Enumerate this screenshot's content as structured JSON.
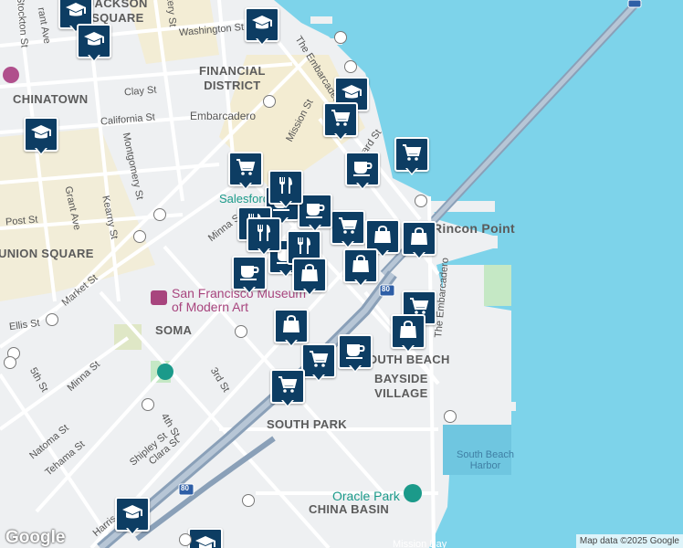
{
  "map": {
    "attribution": "Map data ©2025 Google",
    "logo": "Google",
    "colors": {
      "water": "#7dd3ea",
      "land": "#eef0f2",
      "park": "#c5e8c5",
      "highway": "#8aa0b8",
      "pin": "#0d3d63",
      "yellow": "#f7e9b8"
    }
  },
  "areas": [
    {
      "id": "jackson-square",
      "text": "JACKSON\nSQUARE"
    },
    {
      "id": "chinatown",
      "text": "CHINATOWN"
    },
    {
      "id": "financial-district",
      "text": "FINANCIAL\nDISTRICT"
    },
    {
      "id": "union-square",
      "text": "UNION SQUARE"
    },
    {
      "id": "soma",
      "text": "SOMA"
    },
    {
      "id": "south-beach",
      "text": "SOUTH BEACH"
    },
    {
      "id": "bayside-village",
      "text": "BAYSIDE\nVILLAGE"
    },
    {
      "id": "south-park",
      "text": "SOUTH PARK"
    },
    {
      "id": "china-basin",
      "text": "CHINA BASIN"
    },
    {
      "id": "rincon-point",
      "text": "Rincon Point"
    }
  ],
  "streets": [
    {
      "id": "washington-st",
      "text": "Washington St"
    },
    {
      "id": "clay-st",
      "text": "Clay St"
    },
    {
      "id": "california-st",
      "text": "California St"
    },
    {
      "id": "embarcadero-station",
      "text": "Embarcadero"
    },
    {
      "id": "mission-st",
      "text": "Mission St"
    },
    {
      "id": "howard-st",
      "text": "Howard St"
    },
    {
      "id": "the-embarcadero-n",
      "text": "The Embarcadero"
    },
    {
      "id": "the-embarcadero-s",
      "text": "The Embarcadero"
    },
    {
      "id": "montgomery-st",
      "text": "Montgomery St"
    },
    {
      "id": "kearny-st",
      "text": "Kearny St"
    },
    {
      "id": "grant-ave",
      "text": "Grant Ave"
    },
    {
      "id": "post-st",
      "text": "Post St"
    },
    {
      "id": "market-st",
      "text": "Market St"
    },
    {
      "id": "ellis-st",
      "text": "Ellis St"
    },
    {
      "id": "minna-st",
      "text": "Minna St"
    },
    {
      "id": "minna-st-2",
      "text": "Minna St"
    },
    {
      "id": "5th-st",
      "text": "5th St"
    },
    {
      "id": "3rd-st",
      "text": "3rd St"
    },
    {
      "id": "4th-st",
      "text": "4th St"
    },
    {
      "id": "natoma-st",
      "text": "Natoma St"
    },
    {
      "id": "tehama-st",
      "text": "Tehama St"
    },
    {
      "id": "shipley-st",
      "text": "Shipley St"
    },
    {
      "id": "clara-st",
      "text": "Clara St"
    },
    {
      "id": "harrison-st",
      "text": "Harris"
    },
    {
      "id": "stockton-st",
      "text": "Stockton St"
    },
    {
      "id": "battery-st",
      "text": "ttery St"
    },
    {
      "id": "grant-ave-n",
      "text": "rant Ave"
    }
  ],
  "pois": [
    {
      "id": "salesforce",
      "text": "Salesforce"
    },
    {
      "id": "sfmoma",
      "text": "San Francisco Museum\nof Modern Art"
    },
    {
      "id": "oracle-park",
      "text": "Oracle Park"
    },
    {
      "id": "south-beach-harbor",
      "text": "South Beach\nHarbor"
    },
    {
      "id": "mission-bay",
      "text": "Mission Bay"
    },
    {
      "id": "sb-lbl",
      "text": "SOUTH BEACH"
    }
  ],
  "highway": {
    "shield": "80"
  },
  "markers": [
    {
      "icon": "school"
    },
    {
      "icon": "school"
    },
    {
      "icon": "school"
    },
    {
      "icon": "school"
    },
    {
      "icon": "school"
    },
    {
      "icon": "school"
    },
    {
      "icon": "school"
    },
    {
      "icon": "cart"
    },
    {
      "icon": "cart"
    },
    {
      "icon": "cart"
    },
    {
      "icon": "cart"
    },
    {
      "icon": "cart"
    },
    {
      "icon": "cart"
    },
    {
      "icon": "cart"
    },
    {
      "icon": "cup"
    },
    {
      "icon": "cup"
    },
    {
      "icon": "cup"
    },
    {
      "icon": "cup"
    },
    {
      "icon": "cup"
    },
    {
      "icon": "cup"
    },
    {
      "icon": "dining"
    },
    {
      "icon": "dining"
    },
    {
      "icon": "dining"
    },
    {
      "icon": "dining"
    },
    {
      "icon": "bag"
    },
    {
      "icon": "bag"
    },
    {
      "icon": "bag"
    },
    {
      "icon": "bag"
    },
    {
      "icon": "bag"
    },
    {
      "icon": "bag"
    }
  ]
}
